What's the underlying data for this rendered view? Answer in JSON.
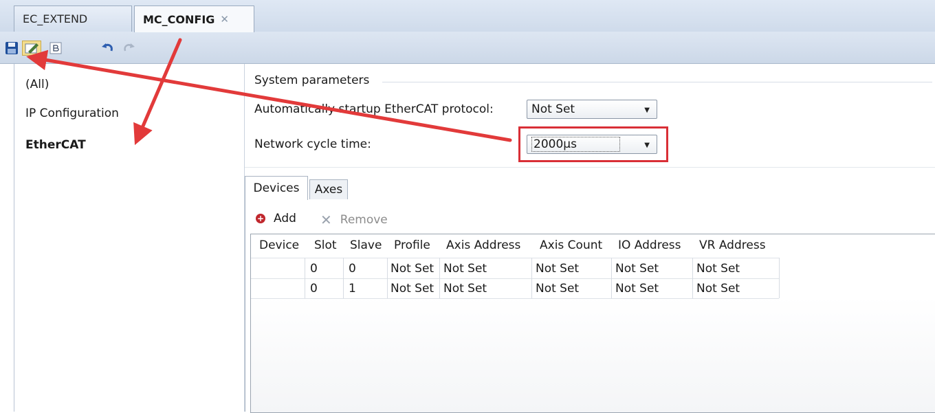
{
  "tabs": [
    {
      "label": "EC_EXTEND",
      "active": false
    },
    {
      "label": "MC_CONFIG",
      "active": true,
      "close": "✕"
    }
  ],
  "toolbar": {
    "icons": [
      "save-icon",
      "edit-icon",
      "b-icon",
      "undo-icon",
      "redo-icon"
    ]
  },
  "sidebar": {
    "items": [
      {
        "label": "(All)"
      },
      {
        "label": "IP Configuration"
      },
      {
        "label": "EtherCAT",
        "selected": true
      }
    ]
  },
  "system": {
    "title": "System parameters",
    "auto_label": "Automatically startup EtherCAT protocol:",
    "auto_value": "Not Set",
    "cycle_label": "Network cycle time:",
    "cycle_value": "2000µs"
  },
  "subtabs": [
    "Devices",
    "Axes"
  ],
  "actions": {
    "add": "Add",
    "remove": "Remove"
  },
  "grid": {
    "columns": [
      "Device",
      "Slot",
      "Slave",
      "Profile",
      "Axis Address",
      "Axis Count",
      "IO Address",
      "VR Address"
    ],
    "rows": [
      [
        "",
        "0",
        "0",
        "Not Set",
        "Not Set",
        "Not Set",
        "Not Set",
        "Not Set"
      ],
      [
        "",
        "0",
        "1",
        "Not Set",
        "Not Set",
        "Not Set",
        "Not Set",
        "Not Set"
      ]
    ]
  },
  "colors": {
    "accent_red": "#d92f36",
    "tab_bar": "#dfe8f4"
  }
}
